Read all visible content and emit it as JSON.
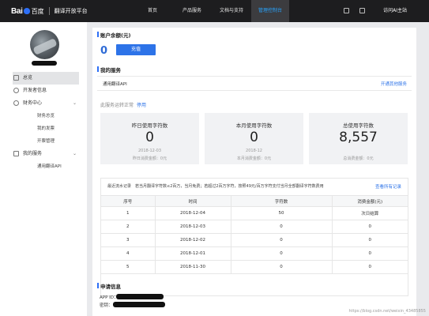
{
  "header": {
    "logo_text": "Bai",
    "logo_cn": "百度",
    "product": "翻译开放平台",
    "nav": [
      {
        "label": "首页",
        "active": false
      },
      {
        "label": "产品服务",
        "active": false
      },
      {
        "label": "文档与支持",
        "active": false
      },
      {
        "label": "管理控制台",
        "active": true
      }
    ],
    "right_link": "访问AI主站"
  },
  "sidebar": {
    "items": [
      {
        "label": "总览",
        "icon": "grid-icon",
        "active": true
      },
      {
        "label": "开发者信息",
        "icon": "user-icon",
        "active": false
      },
      {
        "label": "财务中心",
        "icon": "finance-icon",
        "active": false,
        "expandable": true
      },
      {
        "label": "财务总览",
        "sub": true
      },
      {
        "label": "我的发票",
        "sub": true
      },
      {
        "label": "开票管理",
        "sub": true
      },
      {
        "label": "我的服务",
        "icon": "service-icon",
        "active": false,
        "expandable": true
      },
      {
        "label": "通用翻译API",
        "sub": true
      }
    ]
  },
  "account": {
    "title": "账户余额(元)",
    "balance": "0",
    "recharge_label": "充值"
  },
  "services": {
    "title": "我的服务",
    "service_name": "通用翻译API",
    "open_more": "开通其他服务"
  },
  "stop_note": {
    "text": "此服务运转正常",
    "link": "停用"
  },
  "stats": [
    {
      "label": "昨日使用字符数",
      "value": "0",
      "date": "2018-12-03",
      "amount": "昨日消费金额：0元"
    },
    {
      "label": "本月使用字符数",
      "value": "0",
      "date": "2018-12",
      "amount": "本月消费金额：0元"
    },
    {
      "label": "总使用字符数",
      "value": "8,557",
      "date": "",
      "amount": "总消费金额：0元"
    }
  ],
  "records": {
    "note": "最近流水记录　若当月翻译字符数≤2百万，当月免费；若超过2百万字符，按照49元/百万字符支付当月全部翻译字符数费用",
    "link": "查看所有记录",
    "columns": [
      "序号",
      "时间",
      "字符数",
      "消费金额(元)"
    ],
    "rows": [
      [
        "1",
        "2018-12-04",
        "50",
        "次日结算"
      ],
      [
        "2",
        "2018-12-03",
        "0",
        "0"
      ],
      [
        "3",
        "2018-12-02",
        "0",
        "0"
      ],
      [
        "4",
        "2018-12-01",
        "0",
        "0"
      ],
      [
        "5",
        "2018-11-30",
        "0",
        "0"
      ]
    ]
  },
  "application": {
    "title": "申请信息",
    "app_id_label": "APP ID：",
    "key_label": "密钥："
  },
  "watermark": "https://blog.csdn.net/weixin_43485855",
  "colors": {
    "accent": "#2d73e8",
    "topbar": "#1d1d1f",
    "active_nav": "#29a5ff"
  }
}
